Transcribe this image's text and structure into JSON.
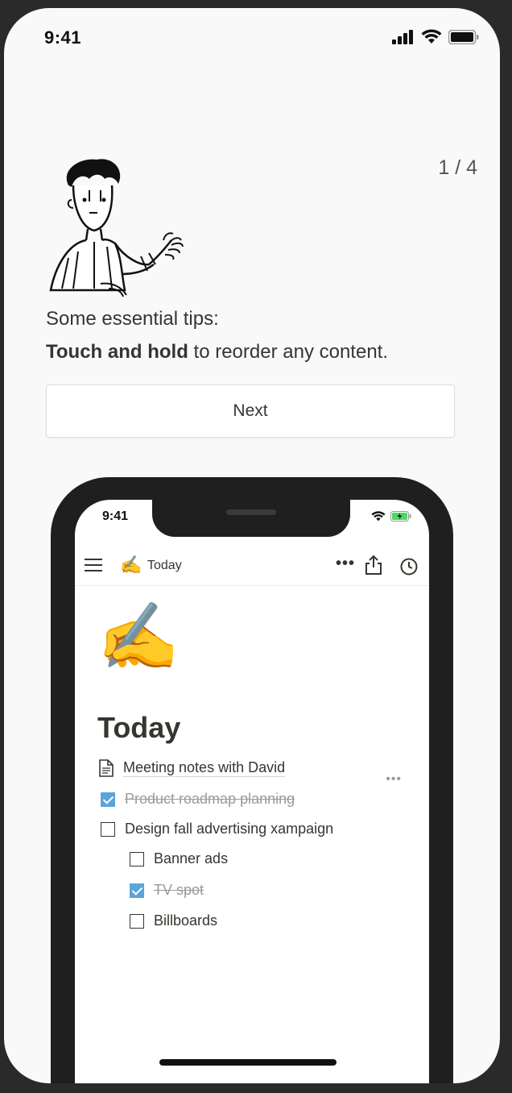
{
  "status_bar": {
    "time": "9:41"
  },
  "page_counter": "1 / 4",
  "tips": {
    "line1": "Some essential tips:",
    "bold": "Touch and hold",
    "rest": " to reorder any content."
  },
  "next_button": {
    "label": "Next"
  },
  "inner_phone": {
    "time": "9:41",
    "toolbar": {
      "emoji": "✍️",
      "title": "Today",
      "more": "•••"
    },
    "page_icon": "✍️",
    "page_title": "Today",
    "blocks": {
      "meeting_notes": "Meeting notes with David",
      "roadmap": "Product roadmap planning",
      "design": "Design fall advertising xampaign",
      "banner": "Banner ads",
      "tv": "TV spot",
      "billboards": "Billboards"
    },
    "row_more": "•••"
  },
  "colors": {
    "checkbox_checked": "#5aa5d8",
    "text": "#37352f",
    "muted": "#9b9a97",
    "battery_green": "#4cd964"
  }
}
